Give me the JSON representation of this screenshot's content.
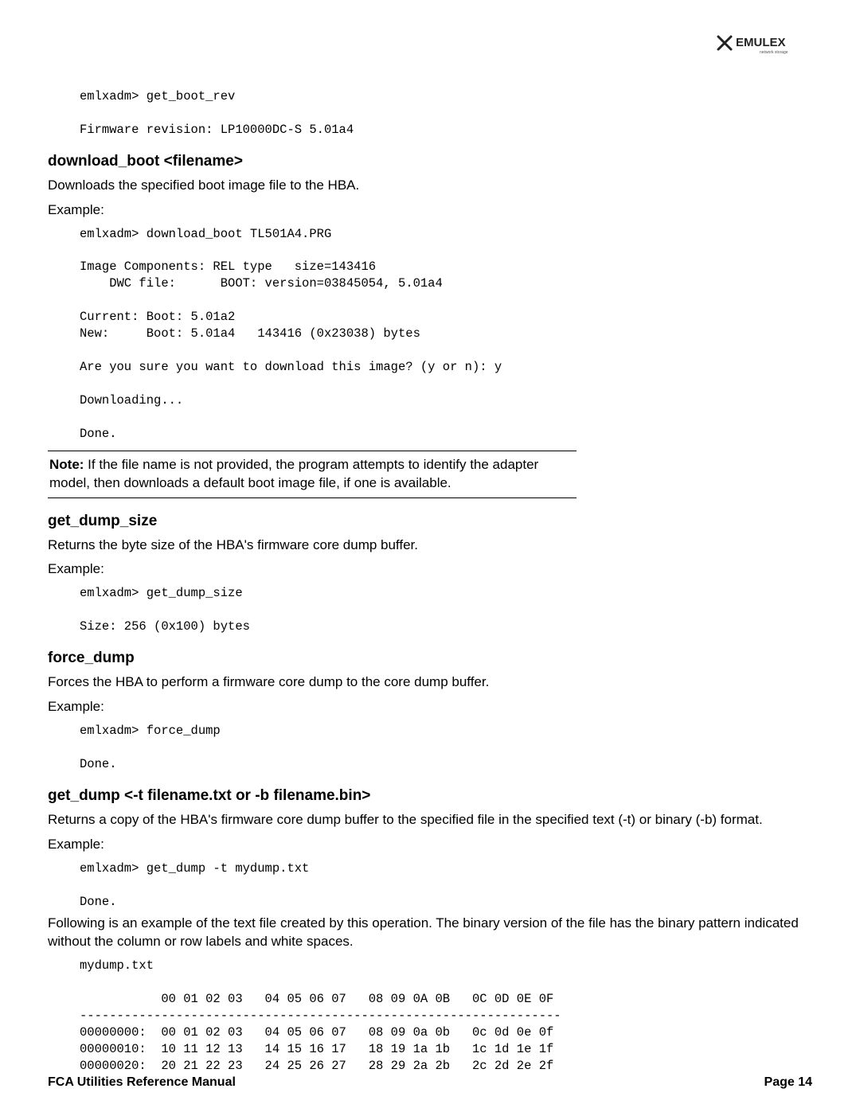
{
  "brand": {
    "name": "EMULEX",
    "tagline": "network storage"
  },
  "sections": {
    "get_boot_rev": {
      "code": "emlxadm> get_boot_rev\n\nFirmware revision: LP10000DC-S 5.01a4"
    },
    "download_boot": {
      "heading": "download_boot <filename>",
      "desc": "Downloads the specified boot image file to the HBA.",
      "example_label": "Example:",
      "code": "emlxadm> download_boot TL501A4.PRG\n\nImage Components: REL type   size=143416\n    DWC file:      BOOT: version=03845054, 5.01a4\n\nCurrent: Boot: 5.01a2\nNew:     Boot: 5.01a4   143416 (0x23038) bytes\n\nAre you sure you want to download this image? (y or n): y\n\nDownloading...\n\nDone.",
      "note_label": "Note: ",
      "note_text": "If the file name is not provided, the program attempts to identify the adapter model, then downloads a default boot image file, if one is available."
    },
    "get_dump_size": {
      "heading": "get_dump_size",
      "desc": "Returns the byte size of the HBA's firmware core dump buffer.",
      "example_label": "Example:",
      "code": "emlxadm> get_dump_size\n\nSize: 256 (0x100) bytes"
    },
    "force_dump": {
      "heading": "force_dump",
      "desc": "Forces the HBA to perform a firmware core dump to the core dump buffer.",
      "example_label": "Example:",
      "code": "emlxadm> force_dump\n\nDone."
    },
    "get_dump": {
      "heading": "get_dump <-t filename.txt or -b filename.bin>",
      "desc": "Returns a copy of the HBA's firmware core dump buffer to the specified file in the specified text (-t) or binary (-b) format.",
      "example_label": "Example:",
      "code": "emlxadm> get_dump -t mydump.txt\n\nDone.",
      "followup": "Following is an example of the text file created by this operation. The binary version of the file has the binary pattern indicated without the column or row labels and white spaces.",
      "dump_code": "mydump.txt\n\n           00 01 02 03   04 05 06 07   08 09 0A 0B   0C 0D 0E 0F\n-----------------------------------------------------------------\n00000000:  00 01 02 03   04 05 06 07   08 09 0a 0b   0c 0d 0e 0f\n00000010:  10 11 12 13   14 15 16 17   18 19 1a 1b   1c 1d 1e 1f\n00000020:  20 21 22 23   24 25 26 27   28 29 2a 2b   2c 2d 2e 2f"
    }
  },
  "footer": {
    "left": "FCA Utilities Reference Manual",
    "right": "Page 14"
  }
}
